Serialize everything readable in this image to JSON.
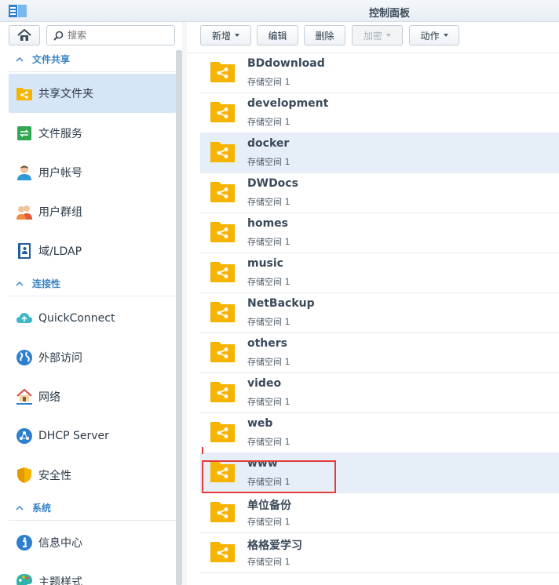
{
  "window": {
    "title": "控制面板"
  },
  "search": {
    "placeholder": "搜索"
  },
  "sidebar": {
    "sections": [
      {
        "label": "文件共享"
      },
      {
        "label": "连接性"
      },
      {
        "label": "系统"
      }
    ],
    "items": [
      {
        "label": "共享文件夹",
        "icon": "shared-folder-icon"
      },
      {
        "label": "文件服务",
        "icon": "file-services-icon"
      },
      {
        "label": "用户帐号",
        "icon": "user-icon"
      },
      {
        "label": "用户群组",
        "icon": "group-icon"
      },
      {
        "label": "域/LDAP",
        "icon": "domain-ldap-icon"
      },
      {
        "label": "QuickConnect",
        "icon": "cloud-icon"
      },
      {
        "label": "外部访问",
        "icon": "globe-icon"
      },
      {
        "label": "网络",
        "icon": "network-house-icon"
      },
      {
        "label": "DHCP Server",
        "icon": "dhcp-icon"
      },
      {
        "label": "安全性",
        "icon": "shield-icon"
      },
      {
        "label": "信息中心",
        "icon": "info-icon"
      },
      {
        "label": "主题样式",
        "icon": "palette-icon"
      }
    ]
  },
  "toolbar": {
    "create": "新增",
    "edit": "编辑",
    "delete": "删除",
    "encrypt": "加密",
    "action": "动作"
  },
  "folders": [
    {
      "name": "BDdownload",
      "volume": "存储空间 1"
    },
    {
      "name": "development",
      "volume": "存储空间 1"
    },
    {
      "name": "docker",
      "volume": "存储空间 1"
    },
    {
      "name": "DWDocs",
      "volume": "存储空间 1"
    },
    {
      "name": "homes",
      "volume": "存储空间 1"
    },
    {
      "name": "music",
      "volume": "存储空间 1"
    },
    {
      "name": "NetBackup",
      "volume": "存储空间 1"
    },
    {
      "name": "others",
      "volume": "存储空间 1"
    },
    {
      "name": "video",
      "volume": "存储空间 1"
    },
    {
      "name": "web",
      "volume": "存储空间 1"
    },
    {
      "name": "www",
      "volume": "存储空间 1"
    },
    {
      "name": "单位备份",
      "volume": "存储空间 1"
    },
    {
      "name": "格格爱学习",
      "volume": "存储空间 1"
    }
  ],
  "colors": {
    "accent": "#3a84c4",
    "folder": "#f6b400",
    "highlight": "#e43b3b",
    "selected": "#d6e6f6"
  }
}
